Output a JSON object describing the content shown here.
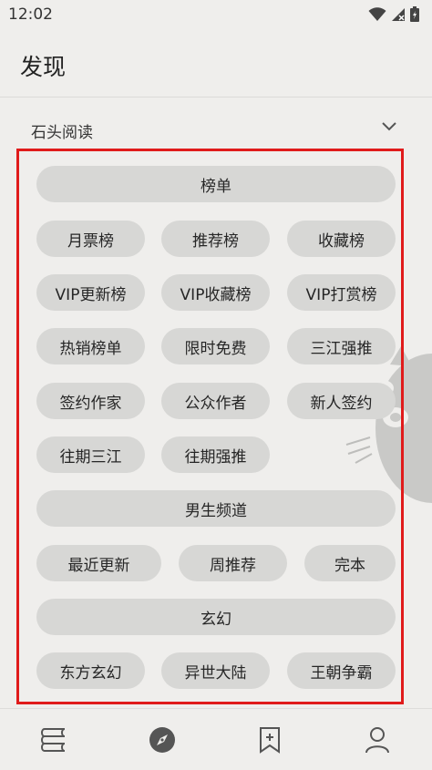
{
  "status_bar": {
    "time": "12:02"
  },
  "header": {
    "title": "发现"
  },
  "source": {
    "name": "石头阅读"
  },
  "sections": [
    {
      "title": "榜单",
      "rows": [
        [
          "月票榜",
          "推荐榜",
          "收藏榜"
        ],
        [
          "VIP更新榜",
          "VIP收藏榜",
          "VIP打赏榜"
        ],
        [
          "热销榜单",
          "限时免费",
          "三江强推"
        ],
        [
          "签约作家",
          "公众作者",
          "新人签约"
        ],
        [
          "往期三江",
          "往期强推"
        ]
      ]
    },
    {
      "title": "男生频道",
      "rows": [
        [
          "最近更新",
          "周推荐",
          "完本"
        ]
      ]
    },
    {
      "title": "玄幻",
      "rows": [
        [
          "东方玄幻",
          "异世大陆",
          "王朝争霸"
        ]
      ]
    }
  ],
  "colors": {
    "accent": "#e01b1b",
    "pill": "#d7d7d5",
    "background": "#efeeec"
  },
  "bottom_nav": [
    {
      "icon": "bookshelf-icon"
    },
    {
      "icon": "compass-icon",
      "active": true
    },
    {
      "icon": "bookmark-add-icon"
    },
    {
      "icon": "user-icon"
    }
  ]
}
